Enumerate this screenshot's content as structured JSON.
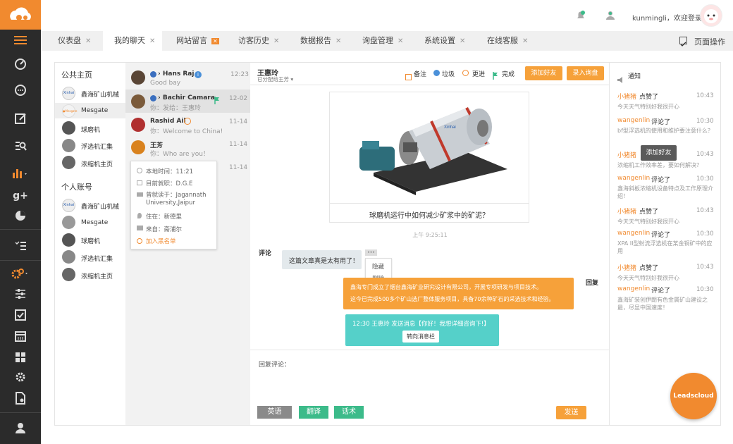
{
  "topbar": {
    "username": "kunmingli，欢迎登录"
  },
  "tabs": [
    {
      "label": "仪表盘"
    },
    {
      "label": "我的聊天"
    },
    {
      "label": "网站留言"
    },
    {
      "label": "访客历史"
    },
    {
      "label": "数据报告"
    },
    {
      "label": "询盘管理"
    },
    {
      "label": "系统设置"
    },
    {
      "label": "在线客服"
    }
  ],
  "page_ops": "页面操作",
  "col1": {
    "public_title": "公共主页",
    "public_items": [
      "鑫海矿山机械",
      "Mesgate",
      "球磨机",
      "浮选机汇集",
      "浓缩机主页"
    ],
    "personal_title": "个人账号",
    "personal_items": [
      "鑫海矿山机械",
      "Mesgate",
      "球磨机",
      "浮选机汇集",
      "浓缩机主页"
    ]
  },
  "chats": [
    {
      "name": "Hans Raj",
      "time": "12:23",
      "preview": "Good bay"
    },
    {
      "name": "Bachir Camara",
      "time": "12-02",
      "preview": "你：发给：王惠玲"
    },
    {
      "name": "Rashid Ail",
      "time": "11-14",
      "preview": "你：Welcome to China!"
    },
    {
      "name": "王芳",
      "time": "11-14",
      "preview": "你：Who are you！"
    },
    {
      "time": "11-14"
    }
  ],
  "profile": {
    "local_time": "本地时间：11:21",
    "job": "目前就职：D.G.E",
    "school": "曾就读于：Jagannath University,Jaipur",
    "live": "住在：新德里",
    "from": "来自：斋浦尔",
    "blacklist": "加入黑名单"
  },
  "conv": {
    "name": "王惠玲",
    "subtitle": "已分配给王芳",
    "actions": [
      "备注",
      "垃圾",
      "更进",
      "完成"
    ],
    "add_friend": "添加好友",
    "inquiry": "录入询盘",
    "image_logo": "Xinhai",
    "caption": "球磨机运行中如何减少矿浆中的矿泥？",
    "timestamp": "上午 9:25:11",
    "comment_label": "评论",
    "comment": "这篇文章真是太有用了！",
    "menu_dots": "•••",
    "menu_hide": "隐藏",
    "menu_delete": "删除",
    "reply_label": "回复",
    "reply_line1": "鑫海专门成立了烟台鑫海矿业研究设计有限公司，开展专项研发与项目技术。",
    "reply_line2": "这今已完成500多个矿山选厂整体服务项目，具备70余种矿石的采选技术和经验。",
    "sys_msg": "12:30 王惠玲 发送消息【你好！我想详细咨询下!】",
    "sys_btn": "转向消息栏",
    "input_label": "回复评论：",
    "btn_en": "英语",
    "btn_translate": "翻译",
    "btn_phrases": "话术",
    "btn_send": "发送"
  },
  "notif": {
    "title": "通知",
    "tooltip": "添加好友",
    "bubble": "Leadscloud",
    "items": [
      {
        "user": "小猪猪",
        "action": "点赞了",
        "time": "10:43",
        "text": "今天天气特别好我很开心"
      },
      {
        "user": "wangenlin",
        "action": "评论了",
        "time": "10:30",
        "text": "bf型浮选机的使用和维护要注意什么？"
      },
      {
        "user": "小猪猪",
        "action": "",
        "time": "10:43",
        "text": "浓缩机工作效率差，要如何解决？"
      },
      {
        "user": "wangenlin",
        "action": "评论了",
        "time": "10:30",
        "text": "鑫海斜板浓缩机设备特点及工作原理介绍！"
      },
      {
        "user": "小猪猪",
        "action": "点赞了",
        "time": "10:43",
        "text": "今天天气特别好我很开心"
      },
      {
        "user": "wangenlin",
        "action": "评论了",
        "time": "10:30",
        "text": "XPA II型射流浮选机在某金铜矿中的应用"
      },
      {
        "user": "小猪猪",
        "action": "点赞了",
        "time": "10:43",
        "text": "今天天气特别好我很开心"
      },
      {
        "user": "wangenlin",
        "action": "评论了",
        "time": "10:30",
        "text": "鑫海矿装创伊朗有色金属矿山建设之最，尽显中国速度！"
      }
    ]
  }
}
